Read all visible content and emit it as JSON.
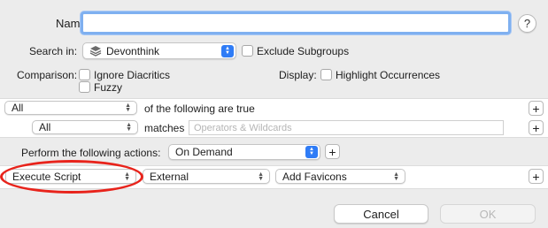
{
  "name_field": {
    "label": "Name:",
    "value": ""
  },
  "help_button": {
    "glyph": "?"
  },
  "search_in": {
    "label": "Search in:",
    "selected": "Devonthink",
    "icon": "database-stack-icon"
  },
  "exclude_subgroups": {
    "label": "Exclude Subgroups",
    "checked": false
  },
  "comparison": {
    "label": "Comparison:",
    "options": [
      {
        "label": "Ignore Diacritics",
        "checked": false
      },
      {
        "label": "Fuzzy",
        "checked": false
      }
    ]
  },
  "display": {
    "label": "Display:",
    "option": {
      "label": "Highlight Occurrences",
      "checked": false
    }
  },
  "conditions_header": {
    "match_selected": "All",
    "suffix": "of the following are true"
  },
  "condition_row": {
    "field_selected": "All",
    "operator": "matches",
    "value_placeholder": "Operators & Wildcards",
    "value": ""
  },
  "actions": {
    "label": "Perform the following actions:",
    "trigger_selected": "On Demand"
  },
  "action_row": {
    "action_selected": "Execute Script",
    "script_type_selected": "External",
    "script_selected": "Add Favicons"
  },
  "buttons": {
    "cancel": "Cancel",
    "ok": "OK"
  },
  "plus_glyph": "+",
  "colors": {
    "accent": "#2f7cf6",
    "highlight_circle": "#e8231b",
    "focus_ring": "#7fb0f0"
  }
}
